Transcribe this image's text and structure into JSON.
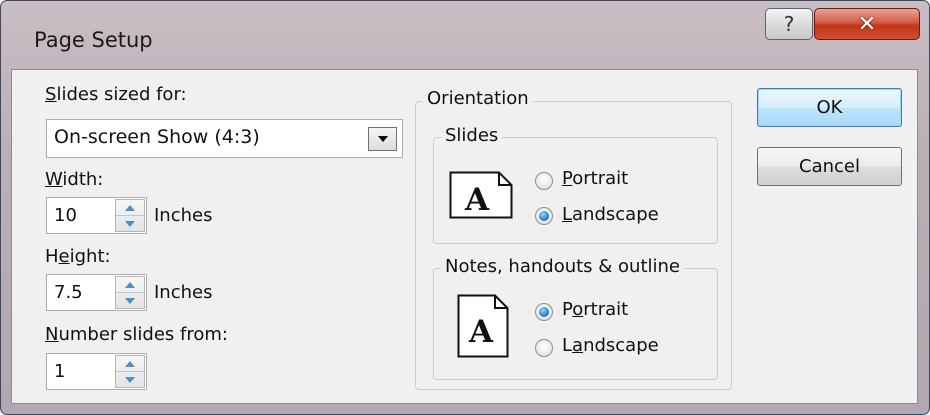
{
  "window": {
    "title": "Page Setup",
    "help_glyph": "?",
    "close_glyph": "✕"
  },
  "slides_sized_for": {
    "label_underlined": "S",
    "label_rest": "lides sized for:",
    "selected": "On-screen Show (4:3)"
  },
  "width": {
    "label_underlined": "W",
    "label_rest": "idth:",
    "value": "10",
    "unit": "Inches"
  },
  "height": {
    "label_pre": "H",
    "label_underlined": "e",
    "label_rest": "ight:",
    "value": "7.5",
    "unit": "Inches"
  },
  "number_slides_from": {
    "label_underlined": "N",
    "label_rest": "umber slides from:",
    "value": "1"
  },
  "orientation": {
    "title": "Orientation",
    "slides": {
      "title": "Slides",
      "portrait": {
        "pre": "",
        "underlined": "P",
        "rest": "ortrait",
        "checked": false
      },
      "landscape": {
        "pre": "",
        "underlined": "L",
        "rest": "andscape",
        "checked": true
      }
    },
    "notes": {
      "title": "Notes, handouts & outline",
      "portrait": {
        "pre": "P",
        "underlined": "o",
        "rest": "rtrait",
        "checked": true
      },
      "landscape": {
        "pre": "L",
        "underlined": "a",
        "rest": "ndscape",
        "checked": false
      }
    }
  },
  "buttons": {
    "ok": "OK",
    "cancel": "Cancel"
  },
  "page_icon_letter": "A"
}
